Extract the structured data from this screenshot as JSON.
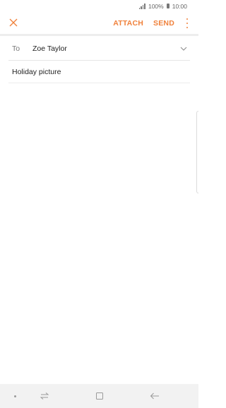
{
  "status_bar": {
    "battery": "100%",
    "time": "10:00"
  },
  "toolbar": {
    "close_icon": "close-icon",
    "attach_label": "ATTACH",
    "send_label": "SEND",
    "more_icon": "more-vertical-icon"
  },
  "compose": {
    "to_label": "To",
    "recipient": "Zoe Taylor",
    "expand_icon": "chevron-down-icon",
    "subject": "Holiday picture",
    "body": ""
  },
  "nav_bar": {
    "icons": [
      "dot-icon",
      "recent-apps-icon",
      "home-icon",
      "back-icon"
    ]
  },
  "colors": {
    "accent": "#f0813b",
    "nav_background": "#f2f2f2"
  }
}
